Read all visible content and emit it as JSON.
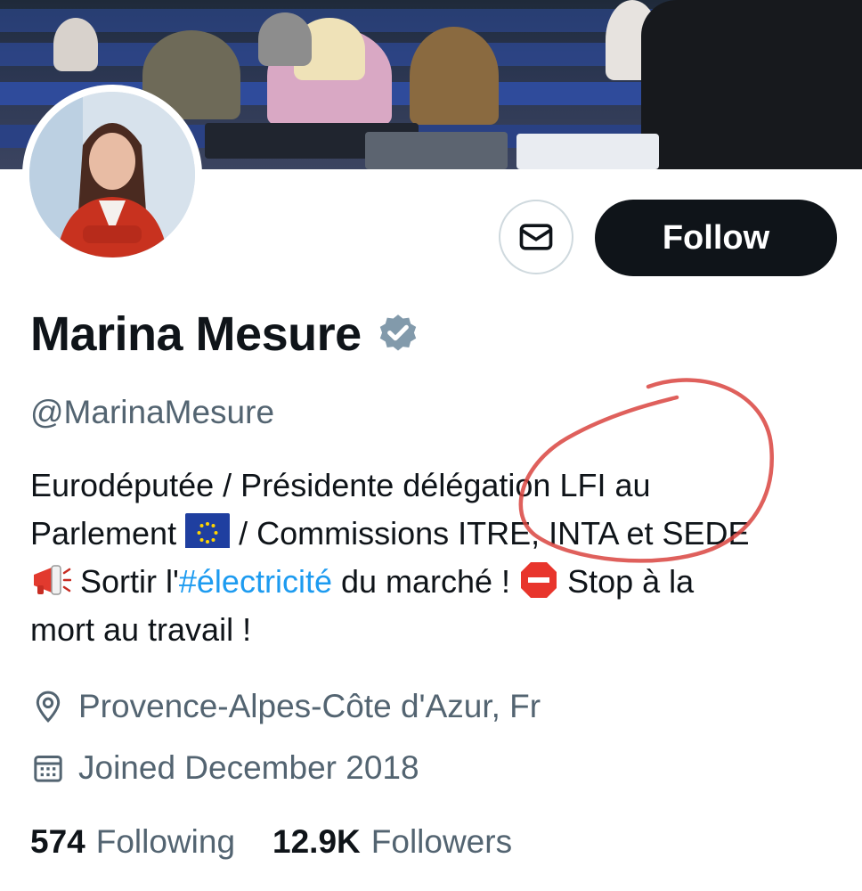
{
  "profile": {
    "display_name": "Marina Mesure",
    "handle": "@MarinaMesure",
    "bio": {
      "line1": "Eurodéputée / Présidente délégation LFI au",
      "line2_a": "Parlement",
      "line2_b": " / Commissions ITRE, INTA et SEDE",
      "line3_a": " Sortir l'",
      "line3_hashtag": "#électricité",
      "line3_b": " du marché ! ",
      "line3_c": " Stop à la",
      "line4": "mort au travail !"
    },
    "location": "Provence-Alpes-Côte d'Azur, Fr",
    "joined": "Joined December 2018",
    "following_count": "574",
    "following_label": "Following",
    "followers_count": "12.9K",
    "followers_label": "Followers"
  },
  "actions": {
    "follow_label": "Follow"
  },
  "icons": {
    "message": "envelope-icon",
    "verified": "verified-badge-icon",
    "location": "location-pin-icon",
    "calendar": "calendar-icon",
    "eu_flag": "eu-flag-emoji",
    "megaphone": "megaphone-emoji",
    "stop": "stop-sign-emoji"
  },
  "colors": {
    "accent_link": "#1d9bf0",
    "secondary_text": "#536471",
    "primary_text": "#0f1419",
    "annotation_red": "#d9443f"
  }
}
